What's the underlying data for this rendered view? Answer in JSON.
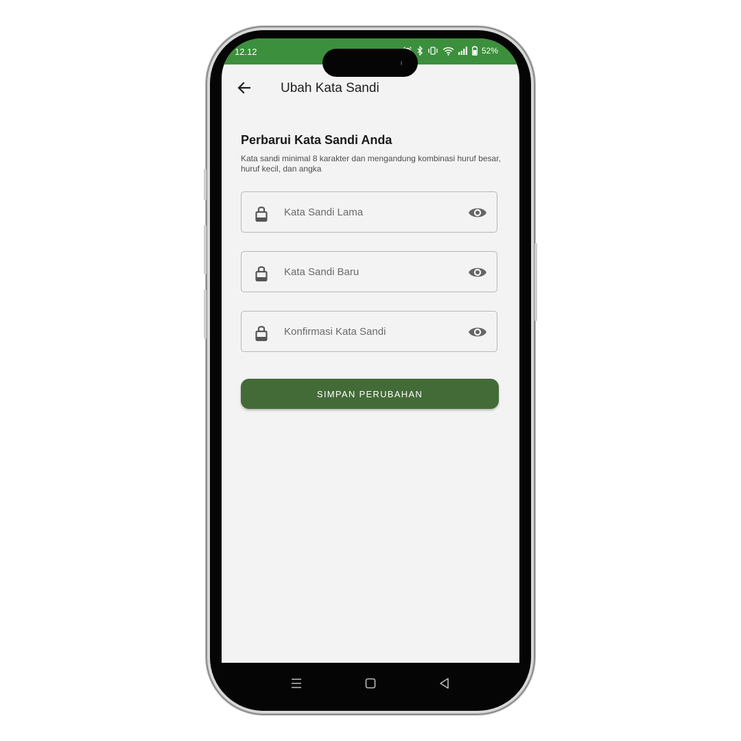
{
  "status_bar": {
    "time": "12.12",
    "battery": "52%",
    "color": "#3c8f3c",
    "icons": [
      "alarm-icon",
      "bluetooth-icon",
      "vibrate-icon",
      "wifi-icon",
      "signal-icon",
      "battery-icon"
    ]
  },
  "app_bar": {
    "title": "Ubah Kata Sandi",
    "back_icon": "arrow-left-icon"
  },
  "section": {
    "title": "Perbarui Kata Sandi Anda",
    "description": "Kata sandi minimal 8 karakter dan mengandung kombinasi huruf besar, huruf kecil, dan angka"
  },
  "fields": [
    {
      "placeholder": "Kata Sandi Lama",
      "value": "",
      "icon": "lock-icon",
      "toggle_icon": "eye-icon"
    },
    {
      "placeholder": "Kata Sandi Baru",
      "value": "",
      "icon": "lock-icon",
      "toggle_icon": "eye-icon"
    },
    {
      "placeholder": "Konfirmasi Kata Sandi",
      "value": "",
      "icon": "lock-icon",
      "toggle_icon": "eye-icon"
    }
  ],
  "save_button": {
    "label": "SIMPAN PERUBAHAN",
    "color": "#436b37"
  },
  "nav_bar": {
    "icons": [
      "menu-icon",
      "home-square-icon",
      "back-triangle-icon"
    ]
  }
}
